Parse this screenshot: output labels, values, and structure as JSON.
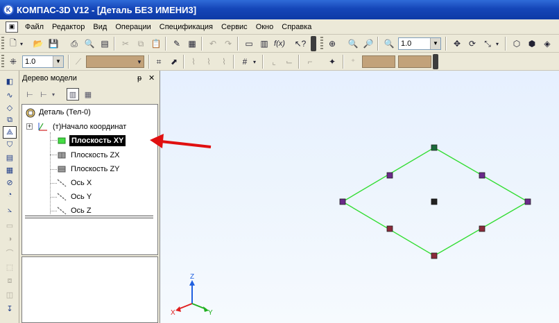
{
  "window": {
    "title": "КОМПАС-3D V12 - [Деталь БЕЗ ИМЕНИ3]",
    "logo_letter": "K"
  },
  "menu": {
    "items": [
      "Файл",
      "Редактор",
      "Вид",
      "Операции",
      "Спецификация",
      "Сервис",
      "Окно",
      "Справка"
    ]
  },
  "toolbar_main": {
    "zoom_value": "1.0"
  },
  "toolbar_second": {
    "step_value": "1.0"
  },
  "model_tree": {
    "title": "Дерево модели",
    "pin_glyph": "ᵽ",
    "close_glyph": "✕",
    "root": "Деталь (Тел-0)",
    "origin": "(т)Начало координат",
    "expand_glyph": "+",
    "children": [
      {
        "label": "Плоскость XY",
        "selected": true,
        "icon": "plane-green-icon"
      },
      {
        "label": "Плоскость ZX",
        "selected": false,
        "icon": "plane-gray-icon"
      },
      {
        "label": "Плоскость ZY",
        "selected": false,
        "icon": "plane-gray-icon"
      },
      {
        "label": "Ось X",
        "selected": false,
        "icon": "axis-icon"
      },
      {
        "label": "Ось Y",
        "selected": false,
        "icon": "axis-icon"
      },
      {
        "label": "Ось Z",
        "selected": false,
        "icon": "axis-icon"
      }
    ]
  },
  "axis_triad": {
    "x_label": "X",
    "y_label": "Y",
    "z_label": "Z",
    "x_color": "#e02020",
    "y_color": "#20b020",
    "z_color": "#2060e0"
  },
  "colors": {
    "plane_outline": "#33dd33",
    "annotation_arrow": "#e01010",
    "viewport_bg": "#eaf2fe",
    "selection_bg": "#000000"
  }
}
